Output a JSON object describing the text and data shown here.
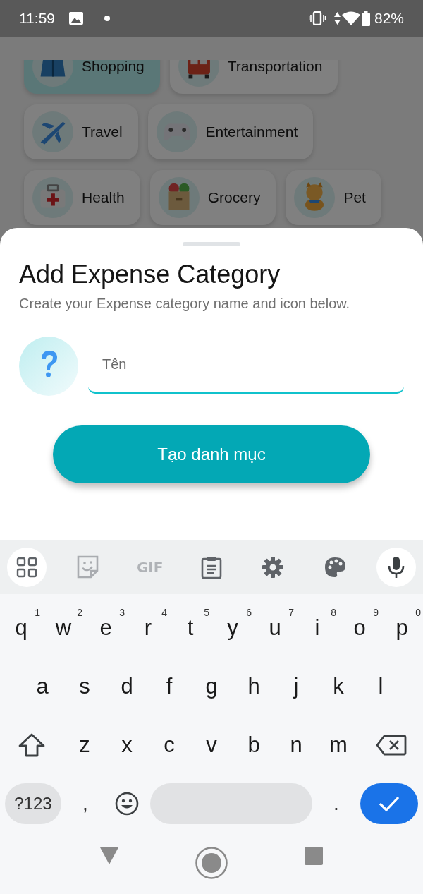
{
  "status_bar": {
    "time": "11:59",
    "battery": "82%"
  },
  "categories": [
    [
      {
        "label": "Shopping",
        "selected": true
      },
      {
        "label": "Transportation",
        "selected": false
      }
    ],
    [
      {
        "label": "Travel",
        "selected": false
      },
      {
        "label": "Entertainment",
        "selected": false
      }
    ],
    [
      {
        "label": "Health",
        "selected": false
      },
      {
        "label": "Grocery",
        "selected": false
      },
      {
        "label": "Pet",
        "selected": false
      }
    ]
  ],
  "sheet": {
    "title": "Add Expense Category",
    "subtitle": "Create your Expense category name and icon below.",
    "name_field": {
      "placeholder": "Tên"
    },
    "submit_button": "Tạo danh mục"
  },
  "keyboard": {
    "toolbar": {
      "gif": "GIF"
    },
    "rows": [
      [
        {
          "label": "q",
          "hint": "1"
        },
        {
          "label": "w",
          "hint": "2"
        },
        {
          "label": "e",
          "hint": "3"
        },
        {
          "label": "r",
          "hint": "4"
        },
        {
          "label": "t",
          "hint": "5"
        },
        {
          "label": "y",
          "hint": "6"
        },
        {
          "label": "u",
          "hint": "7"
        },
        {
          "label": "i",
          "hint": "8"
        },
        {
          "label": "o",
          "hint": "9"
        },
        {
          "label": "p",
          "hint": "0"
        }
      ],
      [
        {
          "label": "a"
        },
        {
          "label": "s"
        },
        {
          "label": "d"
        },
        {
          "label": "f"
        },
        {
          "label": "g"
        },
        {
          "label": "h"
        },
        {
          "label": "j"
        },
        {
          "label": "k"
        },
        {
          "label": "l"
        }
      ],
      [
        {
          "label": "z"
        },
        {
          "label": "x"
        },
        {
          "label": "c"
        },
        {
          "label": "v"
        },
        {
          "label": "b"
        },
        {
          "label": "n"
        },
        {
          "label": "m"
        }
      ]
    ],
    "symbols_key": "?123",
    "comma_key": ",",
    "period_key": "."
  }
}
